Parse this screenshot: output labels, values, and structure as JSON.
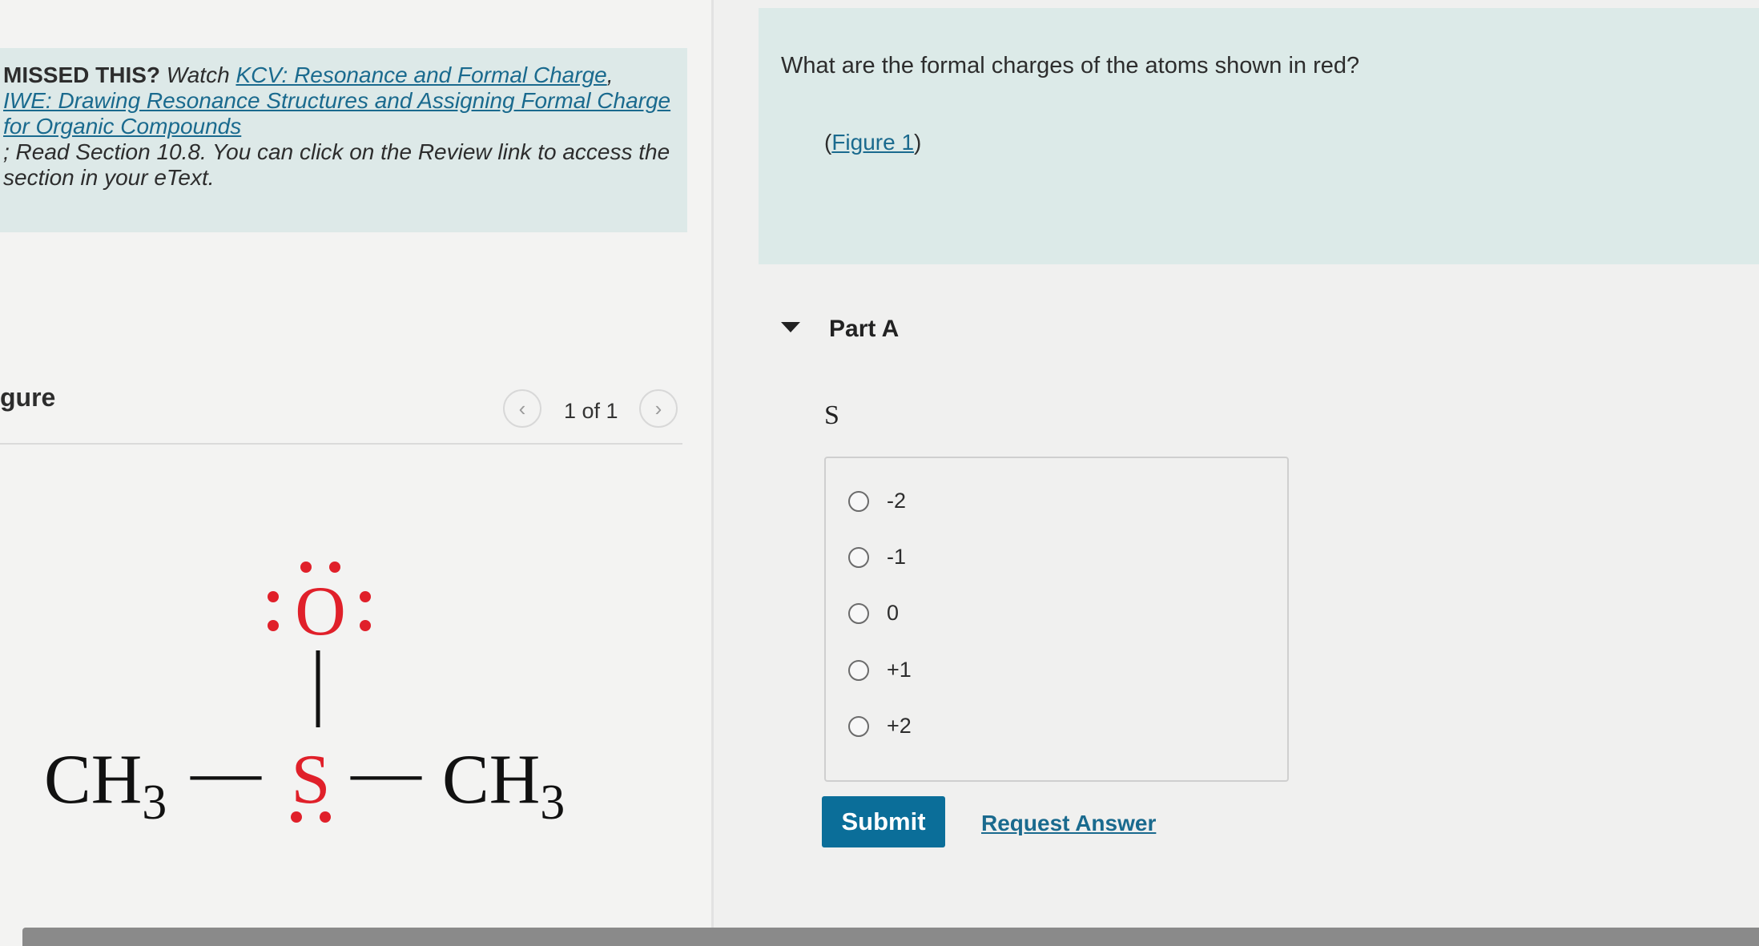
{
  "missed": {
    "lead": "MISSED THIS?",
    "watch": "Watch",
    "links": [
      "KCV: Resonance and Formal Charge",
      "IWE: Drawing Resonance Structures and Assigning Formal Charge for Organic Compounds"
    ],
    "sep": ",",
    "trailing": "; Read Section 10.8. You can click on the Review link to access the section in your eText."
  },
  "figure_panel": {
    "label": "gure",
    "counter": "1 of 1",
    "prev_icon": "chevron-left-icon",
    "next_icon": "chevron-right-icon"
  },
  "molecule": {
    "left_group": "CH",
    "left_sub": "3",
    "center_atom": "S",
    "top_atom": "O",
    "right_group": "CH",
    "right_sub": "3",
    "bond": "—",
    "red_color": "#e0202a"
  },
  "question": {
    "text": "What are the formal charges of the atoms shown in red?",
    "figure_open": "(",
    "figure_link": "Figure 1",
    "figure_close": ")"
  },
  "part": {
    "title": "Part A",
    "atom": "S",
    "options": [
      "-2",
      "-1",
      "0",
      "+1",
      "+2"
    ],
    "submit_label": "Submit",
    "request_label": "Request Answer"
  },
  "colors": {
    "accent": "#0b6e99",
    "link": "#1a6a8e",
    "panel": "#dceae8"
  }
}
